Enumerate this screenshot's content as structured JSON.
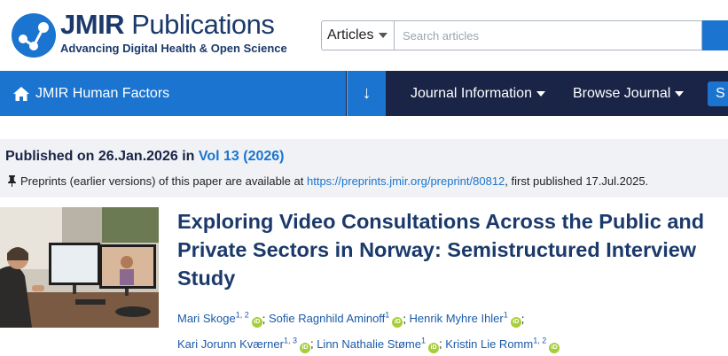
{
  "header": {
    "brand_bold": "JMIR",
    "brand_light": " Publications",
    "tagline": "Advancing Digital Health & Open Science",
    "search": {
      "scope": "Articles",
      "placeholder": "Search articles"
    }
  },
  "nav": {
    "journal": "JMIR Human Factors",
    "down_arrow": "↓",
    "menu": [
      "Journal Information",
      "Browse Journal"
    ],
    "submit_partial": "S"
  },
  "publication": {
    "published_prefix": "Published on 26.Jan.2026 in ",
    "volume": "Vol 13 (2026)",
    "preprint_prefix": "Preprints (earlier versions) of this paper are available at ",
    "preprint_url": "https://preprints.jmir.org/preprint/80812",
    "preprint_suffix": ", first published 17.Jul.2025."
  },
  "article": {
    "title": "Exploring Video Consultations Across the Public and Private Sectors in Norway: Semistructured Interview Study",
    "authors": [
      {
        "name": "Mari Skoge",
        "aff": "1, 2"
      },
      {
        "name": "Sofie Ragnhild Aminoff",
        "aff": "1"
      },
      {
        "name": "Henrik Myhre Ihler",
        "aff": "1"
      },
      {
        "name": "Kari Jorunn Kværner",
        "aff": "1, 3"
      },
      {
        "name": "Linn Nathalie Støme",
        "aff": "1"
      },
      {
        "name": "Kristin Lie Romm",
        "aff": "1, 2"
      }
    ]
  },
  "colors": {
    "brand_blue": "#1b75d0",
    "navy": "#1a2447",
    "orcid_green": "#a6ce39"
  },
  "icons": [
    "jmir-logo-icon",
    "chevron-down-icon",
    "search-icon",
    "home-icon",
    "arrow-down-icon",
    "pin-icon",
    "orcid-icon"
  ]
}
